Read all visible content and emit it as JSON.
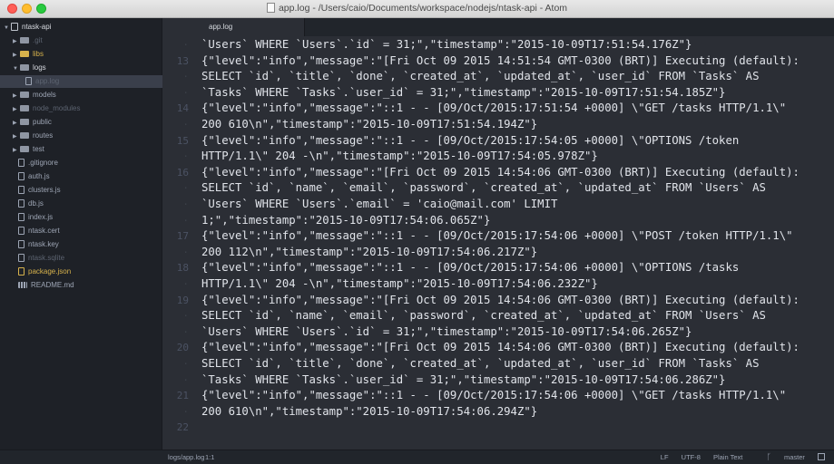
{
  "window": {
    "title": "app.log - /Users/caio/Documents/workspace/nodejs/ntask-api - Atom"
  },
  "sidebar": {
    "root": "ntask-api",
    "items": [
      {
        "label": ".git",
        "kind": "folder",
        "color": "dim"
      },
      {
        "label": "libs",
        "kind": "folder",
        "color": "yellow"
      },
      {
        "label": "logs",
        "kind": "folder",
        "color": "bright",
        "open": true
      },
      {
        "label": "app.log",
        "kind": "file",
        "color": "dim",
        "selected": true
      },
      {
        "label": "models",
        "kind": "folder",
        "color": "normal"
      },
      {
        "label": "node_modules",
        "kind": "folder",
        "color": "dim"
      },
      {
        "label": "public",
        "kind": "folder",
        "color": "normal"
      },
      {
        "label": "routes",
        "kind": "folder",
        "color": "normal"
      },
      {
        "label": "test",
        "kind": "folder",
        "color": "normal"
      },
      {
        "label": ".gitignore",
        "kind": "file",
        "color": "normal"
      },
      {
        "label": "auth.js",
        "kind": "file",
        "color": "normal"
      },
      {
        "label": "clusters.js",
        "kind": "file",
        "color": "normal"
      },
      {
        "label": "db.js",
        "kind": "file",
        "color": "normal"
      },
      {
        "label": "index.js",
        "kind": "file",
        "color": "normal"
      },
      {
        "label": "ntask.cert",
        "kind": "file",
        "color": "normal"
      },
      {
        "label": "ntask.key",
        "kind": "file",
        "color": "normal"
      },
      {
        "label": "ntask.sqlite",
        "kind": "file",
        "color": "dim"
      },
      {
        "label": "package.json",
        "kind": "file",
        "color": "yellow"
      },
      {
        "label": "README.md",
        "kind": "grid",
        "color": "normal"
      }
    ]
  },
  "tabs": [
    {
      "label": "app.log",
      "active": true
    }
  ],
  "editor": {
    "lines": [
      {
        "num": "",
        "text": "`Users` WHERE `Users`.`id` = 31;\",\"timestamp\":\"2015-10-09T17:51:54.176Z\"}"
      },
      {
        "num": "13",
        "text": "{\"level\":\"info\",\"message\":\"[Fri Oct 09 2015 14:51:54 GMT-0300 (BRT)] Executing (default):"
      },
      {
        "num": "",
        "text": "SELECT `id`, `title`, `done`, `created_at`, `updated_at`, `user_id` FROM `Tasks` AS"
      },
      {
        "num": "",
        "text": "`Tasks` WHERE `Tasks`.`user_id` = 31;\",\"timestamp\":\"2015-10-09T17:51:54.185Z\"}"
      },
      {
        "num": "14",
        "text": "{\"level\":\"info\",\"message\":\"::1 - - [09/Oct/2015:17:51:54 +0000] \\\"GET /tasks HTTP/1.1\\\""
      },
      {
        "num": "",
        "text": "200 610\\n\",\"timestamp\":\"2015-10-09T17:51:54.194Z\"}"
      },
      {
        "num": "15",
        "text": "{\"level\":\"info\",\"message\":\"::1 - - [09/Oct/2015:17:54:05 +0000] \\\"OPTIONS /token"
      },
      {
        "num": "",
        "text": "HTTP/1.1\\\" 204 -\\n\",\"timestamp\":\"2015-10-09T17:54:05.978Z\"}"
      },
      {
        "num": "16",
        "text": "{\"level\":\"info\",\"message\":\"[Fri Oct 09 2015 14:54:06 GMT-0300 (BRT)] Executing (default):"
      },
      {
        "num": "",
        "text": "SELECT `id`, `name`, `email`, `password`, `created_at`, `updated_at` FROM `Users` AS"
      },
      {
        "num": "",
        "text": "`Users` WHERE `Users`.`email` = 'caio@mail.com' LIMIT"
      },
      {
        "num": "",
        "text": "1;\",\"timestamp\":\"2015-10-09T17:54:06.065Z\"}"
      },
      {
        "num": "17",
        "text": "{\"level\":\"info\",\"message\":\"::1 - - [09/Oct/2015:17:54:06 +0000] \\\"POST /token HTTP/1.1\\\""
      },
      {
        "num": "",
        "text": "200 112\\n\",\"timestamp\":\"2015-10-09T17:54:06.217Z\"}"
      },
      {
        "num": "18",
        "text": "{\"level\":\"info\",\"message\":\"::1 - - [09/Oct/2015:17:54:06 +0000] \\\"OPTIONS /tasks"
      },
      {
        "num": "",
        "text": "HTTP/1.1\\\" 204 -\\n\",\"timestamp\":\"2015-10-09T17:54:06.232Z\"}"
      },
      {
        "num": "19",
        "text": "{\"level\":\"info\",\"message\":\"[Fri Oct 09 2015 14:54:06 GMT-0300 (BRT)] Executing (default):"
      },
      {
        "num": "",
        "text": "SELECT `id`, `name`, `email`, `password`, `created_at`, `updated_at` FROM `Users` AS"
      },
      {
        "num": "",
        "text": "`Users` WHERE `Users`.`id` = 31;\",\"timestamp\":\"2015-10-09T17:54:06.265Z\"}"
      },
      {
        "num": "20",
        "text": "{\"level\":\"info\",\"message\":\"[Fri Oct 09 2015 14:54:06 GMT-0300 (BRT)] Executing (default):"
      },
      {
        "num": "",
        "text": "SELECT `id`, `title`, `done`, `created_at`, `updated_at`, `user_id` FROM `Tasks` AS"
      },
      {
        "num": "",
        "text": "`Tasks` WHERE `Tasks`.`user_id` = 31;\",\"timestamp\":\"2015-10-09T17:54:06.286Z\"}"
      },
      {
        "num": "21",
        "text": "{\"level\":\"info\",\"message\":\"::1 - - [09/Oct/2015:17:54:06 +0000] \\\"GET /tasks HTTP/1.1\\\""
      },
      {
        "num": "",
        "text": "200 610\\n\",\"timestamp\":\"2015-10-09T17:54:06.294Z\"}"
      },
      {
        "num": "22",
        "text": ""
      }
    ]
  },
  "statusbar": {
    "path": "logs/app.log",
    "position": "1:1",
    "line_ending": "LF",
    "encoding": "UTF-8",
    "grammar": "Plain Text",
    "branch": "master"
  }
}
